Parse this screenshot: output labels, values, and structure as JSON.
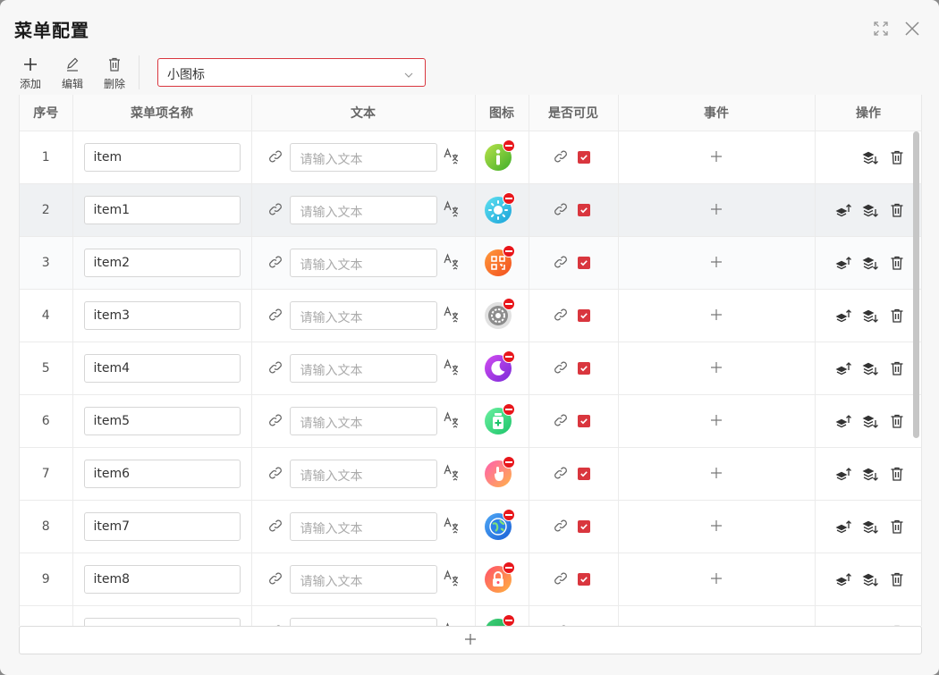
{
  "dialog": {
    "title": "菜单配置"
  },
  "toolbar": {
    "add_label": "添加",
    "edit_label": "编辑",
    "delete_label": "删除",
    "icon_size_select": "小图标"
  },
  "table": {
    "columns": [
      "序号",
      "菜单项名称",
      "文本",
      "图标",
      "是否可见",
      "事件",
      "操作"
    ],
    "text_placeholder": "请输入文本",
    "rows": [
      {
        "index": "1",
        "name": "item",
        "icon": "info-icon",
        "visible": true
      },
      {
        "index": "2",
        "name": "item1",
        "icon": "brightness-icon",
        "visible": true
      },
      {
        "index": "3",
        "name": "item2",
        "icon": "qr-code-icon",
        "visible": true
      },
      {
        "index": "4",
        "name": "item3",
        "icon": "settings-gear-icon",
        "visible": true
      },
      {
        "index": "5",
        "name": "item4",
        "icon": "moon-icon",
        "visible": true
      },
      {
        "index": "6",
        "name": "item5",
        "icon": "medicine-bottle-icon",
        "visible": true
      },
      {
        "index": "7",
        "name": "item6",
        "icon": "touch-hand-icon",
        "visible": true
      },
      {
        "index": "8",
        "name": "item7",
        "icon": "globe-icon",
        "visible": true
      },
      {
        "index": "9",
        "name": "item8",
        "icon": "lock-icon",
        "visible": true
      },
      {
        "index": "",
        "name": "",
        "icon": "chat-icon",
        "visible": true
      }
    ]
  },
  "colors": {
    "accent": "#d9363e",
    "badge": "#e8161b",
    "hover_row": "#eff1f3"
  }
}
